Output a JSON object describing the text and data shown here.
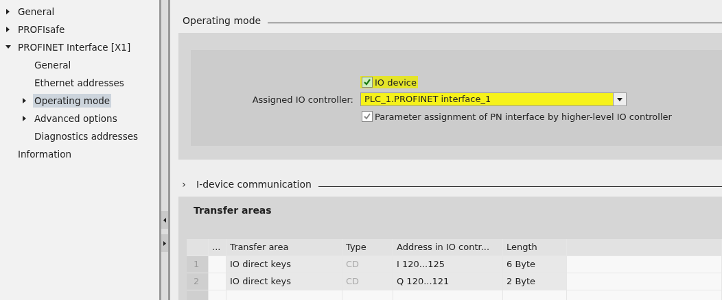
{
  "sidebar": {
    "items": [
      {
        "label": "General",
        "expanded": false,
        "selected": false
      },
      {
        "label": "PROFIsafe",
        "expanded": false,
        "selected": false
      },
      {
        "label": "PROFINET Interface [X1]",
        "expanded": true,
        "selected": false,
        "children": [
          {
            "label": "General",
            "selected": false
          },
          {
            "label": "Ethernet addresses",
            "selected": false
          },
          {
            "label": "Operating mode",
            "expanded": false,
            "selected": true
          },
          {
            "label": "Advanced options",
            "expanded": false,
            "selected": false
          },
          {
            "label": "Diagnostics addresses",
            "selected": false
          }
        ]
      },
      {
        "label": "Information",
        "selected": false
      }
    ]
  },
  "operating_mode": {
    "title": "Operating mode",
    "io_device": {
      "label": "IO device",
      "checked": true,
      "highlighted": true
    },
    "assigned_controller": {
      "label": "Assigned IO controller:",
      "value": "PLC_1.PROFINET interface_1",
      "highlighted": true
    },
    "parameter_assignment": {
      "label": "Parameter assignment of PN interface by higher-level IO controller",
      "checked": true,
      "disabled": true
    }
  },
  "idevice": {
    "title": "I-device communication",
    "chevron": "›"
  },
  "transfer_areas": {
    "title": "Transfer areas",
    "columns": [
      "...",
      "Transfer area",
      "Type",
      "Address in IO contr...",
      "Length"
    ],
    "rows": [
      {
        "index": "1",
        "name": "IO direct keys",
        "type": "CD",
        "address": "I 120...125",
        "length": "6 Byte"
      },
      {
        "index": "2",
        "name": "IO direct keys",
        "type": "CD",
        "address": "Q 120...121",
        "length": "2 Byte"
      }
    ]
  }
}
